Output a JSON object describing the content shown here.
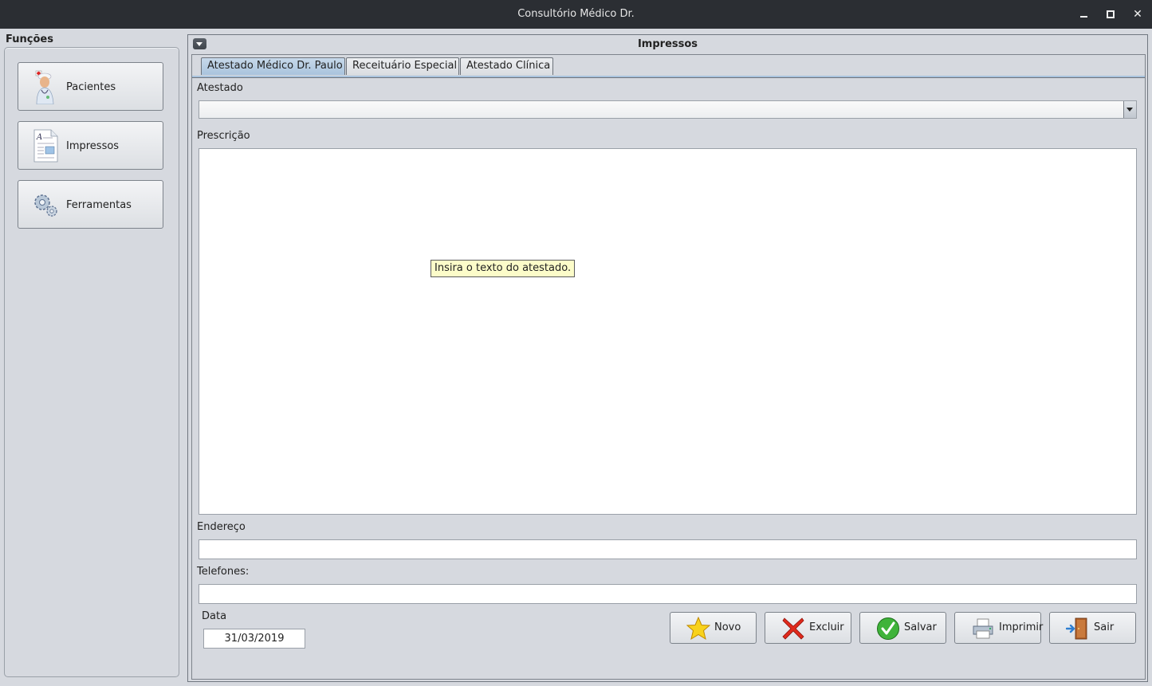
{
  "window": {
    "title": "Consultório Médico Dr."
  },
  "sidebar": {
    "label": "Funções",
    "buttons": [
      {
        "label": "Pacientes",
        "icon": "doctor-icon"
      },
      {
        "label": "Impressos",
        "icon": "document-icon"
      },
      {
        "label": "Ferramentas",
        "icon": "gears-icon"
      }
    ]
  },
  "panel": {
    "title": "Impressos",
    "tabs": [
      {
        "label": "Atestado Médico Dr. Paulo",
        "active": true
      },
      {
        "label": "Receituário Especial",
        "active": false
      },
      {
        "label": "Atestado Clínica",
        "active": false
      }
    ]
  },
  "form": {
    "atestado_label": "Atestado",
    "atestado_value": "",
    "prescricao_label": "Prescrição",
    "prescricao_value": "",
    "tooltip": "Insira o texto do atestado.",
    "endereco_label": "Endereço",
    "endereco_value": "",
    "telefones_label": "Telefones:",
    "telefones_value": "",
    "data_label": "Data",
    "data_value": "31/03/2019"
  },
  "actions": [
    {
      "label": "Novo",
      "icon": "star-icon"
    },
    {
      "label": "Excluir",
      "icon": "red-x-icon"
    },
    {
      "label": "Salvar",
      "icon": "green-check-icon"
    },
    {
      "label": "Imprimir",
      "icon": "printer-icon"
    },
    {
      "label": "Sair",
      "icon": "exit-door-icon"
    }
  ],
  "colors": {
    "titlebar": "#2b2e33",
    "background": "#d6d9df",
    "active_tab": "#a9c3dd",
    "tooltip": "#fcfcc9"
  }
}
